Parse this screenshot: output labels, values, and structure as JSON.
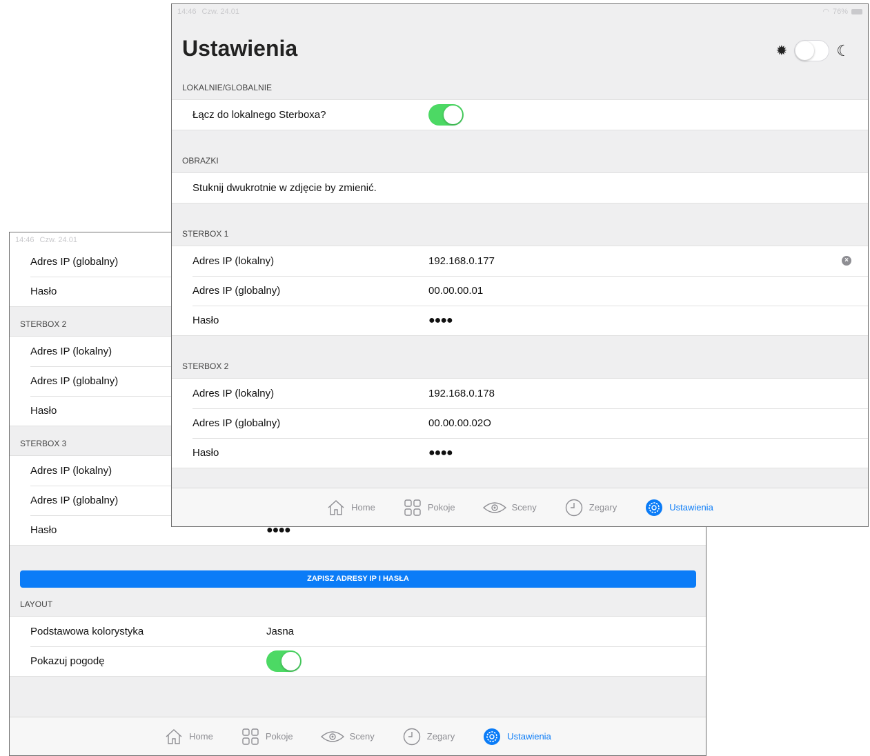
{
  "status": {
    "time": "14:46",
    "date": "Czw. 24.01",
    "battery": "76%"
  },
  "page_title": "Ustawienia",
  "front": {
    "sections": {
      "local": {
        "header": "LOKALNIE/GLOBALNIE",
        "connect_label": "Łącz do lokalnego Sterboxa?",
        "connect_on": true
      },
      "images": {
        "header": "OBRAZKI",
        "hint": "Stuknij dwukrotnie w zdjęcie by zmienić."
      },
      "sterbox1": {
        "header": "STERBOX 1",
        "rows": [
          {
            "label": "Adres IP (lokalny)",
            "value": "192.168.0.177"
          },
          {
            "label": "Adres IP (globalny)",
            "value": "00.00.00.01"
          },
          {
            "label": "Hasło",
            "value": "●●●●"
          }
        ]
      },
      "sterbox2": {
        "header": "STERBOX 2",
        "rows": [
          {
            "label": "Adres IP (lokalny)",
            "value": "192.168.0.178"
          },
          {
            "label": "Adres IP (globalny)",
            "value": "00.00.00.02O"
          },
          {
            "label": "Hasło",
            "value": "●●●●"
          }
        ]
      }
    }
  },
  "back": {
    "top_rows": [
      {
        "label": "Adres IP (globalny)"
      },
      {
        "label": "Hasło"
      }
    ],
    "sterbox2": {
      "header": "STERBOX 2",
      "rows": [
        {
          "label": "Adres IP (lokalny)"
        },
        {
          "label": "Adres IP (globalny)"
        },
        {
          "label": "Hasło"
        }
      ]
    },
    "sterbox3": {
      "header": "STERBOX 3",
      "rows": [
        {
          "label": "Adres IP (lokalny)"
        },
        {
          "label": "Adres IP (globalny)"
        },
        {
          "label": "Hasło",
          "value": "●●●●"
        }
      ]
    },
    "save_button": "ZAPISZ ADRESY IP I HASŁA",
    "layout": {
      "header": "LAYOUT",
      "theme_label": "Podstawowa kolorystyka",
      "theme_value": "Jasna",
      "weather_label": "Pokazuj pogodę",
      "weather_on": true
    }
  },
  "tabs": [
    {
      "label": "Home",
      "icon": "home-icon"
    },
    {
      "label": "Pokoje",
      "icon": "rooms-grid-icon"
    },
    {
      "label": "Sceny",
      "icon": "eye-icon"
    },
    {
      "label": "Zegary",
      "icon": "clock-icon"
    },
    {
      "label": "Ustawienia",
      "icon": "gear-icon",
      "active": true
    }
  ],
  "colors": {
    "accent": "#0b7cf7",
    "toggle_on": "#4cd964"
  }
}
